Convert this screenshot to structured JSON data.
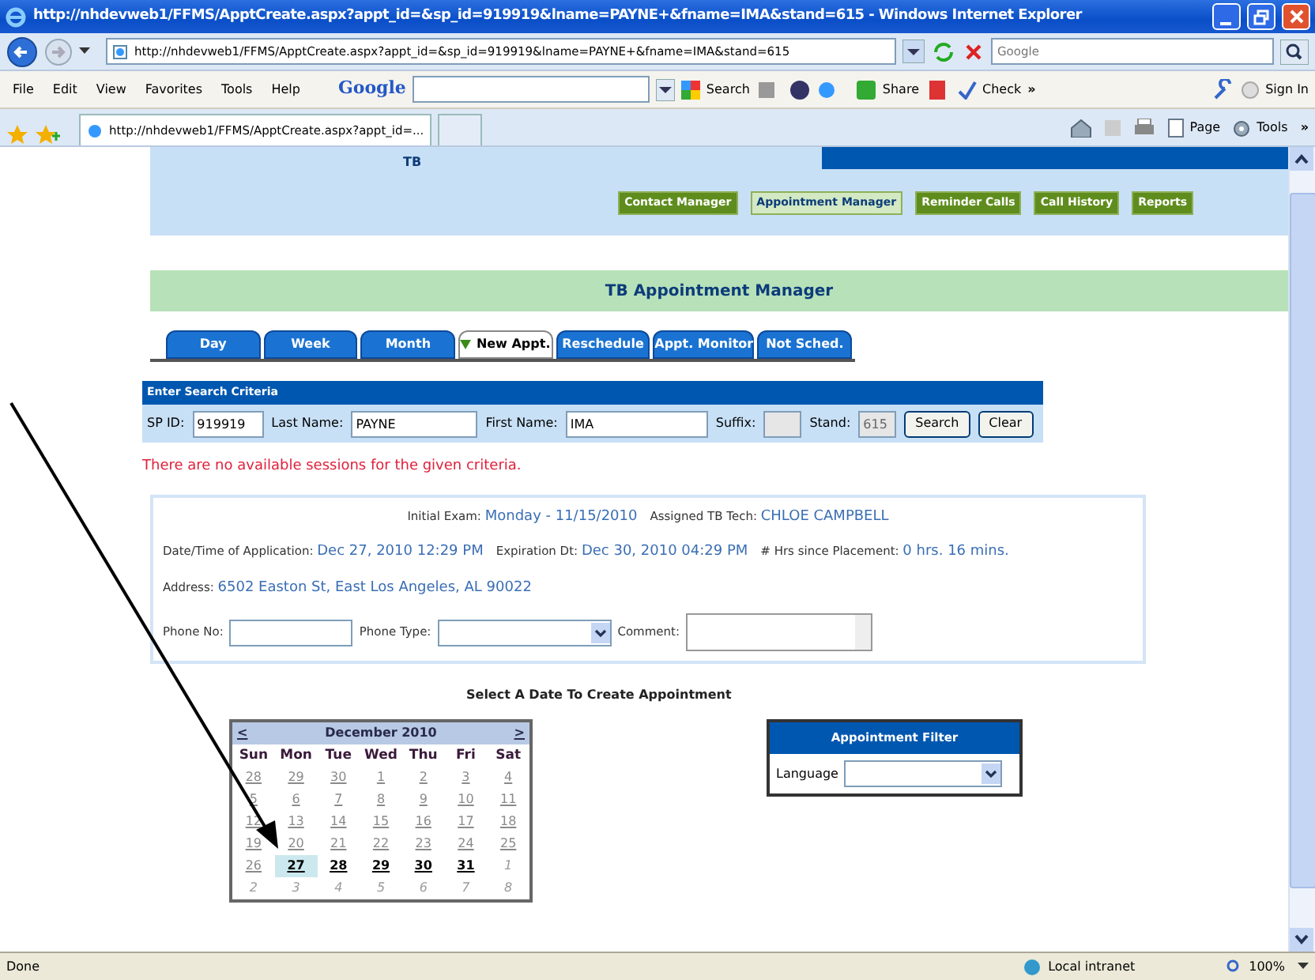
{
  "window": {
    "title": "http://nhdevweb1/FFMS/ApptCreate.aspx?appt_id=&sp_id=919919&lname=PAYNE+&fname=IMA&stand=615 - Windows Internet Explorer"
  },
  "address_bar": {
    "url": "http://nhdevweb1/FFMS/ApptCreate.aspx?appt_id=&sp_id=919919&lname=PAYNE+&fname=IMA&stand=615",
    "search_placeholder": "Google"
  },
  "menu": [
    "File",
    "Edit",
    "View",
    "Favorites",
    "Tools",
    "Help"
  ],
  "google_toolbar": {
    "logo": "Google",
    "search": "Search",
    "share": "Share",
    "check": "Check",
    "more": "»",
    "sign_in": "Sign In"
  },
  "browser_tab": {
    "title": "http://nhdevweb1/FFMS/ApptCreate.aspx?appt_id=..."
  },
  "command_bar": {
    "page": "Page",
    "tools": "Tools",
    "more": "»"
  },
  "page": {
    "header_label": "TB",
    "nav": [
      {
        "label": "Contact Manager",
        "selected": false
      },
      {
        "label": "Appointment Manager",
        "selected": true
      },
      {
        "label": "Reminder Calls",
        "selected": false
      },
      {
        "label": "Call History",
        "selected": false
      },
      {
        "label": "Reports",
        "selected": false
      }
    ],
    "title": "TB Appointment Manager",
    "tabs": [
      {
        "label": "Day",
        "selected": false
      },
      {
        "label": "Week",
        "selected": false
      },
      {
        "label": "Month",
        "selected": false
      },
      {
        "label": "New Appt.",
        "selected": true
      },
      {
        "label": "Reschedule",
        "selected": false
      },
      {
        "label": "Appt. Monitor",
        "selected": false
      },
      {
        "label": "Not Sched.",
        "selected": false
      }
    ],
    "search": {
      "header": "Enter Search Criteria",
      "fields": [
        {
          "label": "SP ID:",
          "value": "919919",
          "disabled": false
        },
        {
          "label": "Last Name:",
          "value": "PAYNE",
          "disabled": false
        },
        {
          "label": "First Name:",
          "value": "IMA",
          "disabled": false
        },
        {
          "label": "Suffix:",
          "disabled": true
        },
        {
          "label": "Stand:",
          "value": "615",
          "disabled": true
        }
      ],
      "buttons": [
        "Search",
        "Clear"
      ]
    },
    "error": "There are no available sessions for the given criteria.",
    "info": {
      "rows": [
        [
          {
            "label": "Initial Exam:",
            "value": "Monday - 11/15/2010"
          },
          {
            "label": "Assigned TB Tech:",
            "value": "CHLOE CAMPBELL"
          }
        ],
        [
          {
            "label": "Date/Time of Application:",
            "value": "Dec 27, 2010 12:29 PM"
          },
          {
            "label": "Expiration Dt:",
            "value": "Dec 30, 2010 04:29 PM"
          },
          {
            "label": "# Hrs since Placement:",
            "value": "0 hrs. 16 mins."
          }
        ],
        [
          {
            "label": "Address:",
            "value": "6502 Easton St, East Los Angeles, AL 90022"
          }
        ]
      ],
      "phone_no_label": "Phone No:",
      "phone_type_label": "Phone Type:",
      "comment_label": "Comment:"
    },
    "select_heading": "Select A Date To Create Appointment",
    "calendar": {
      "prev": "<",
      "next": ">",
      "month": "December 2010",
      "weekdays": [
        "Sun",
        "Mon",
        "Tue",
        "Wed",
        "Thu",
        "Fri",
        "Sat"
      ],
      "weeks": [
        [
          {
            "day": "28",
            "available": false,
            "outside": false,
            "selected": false
          },
          {
            "day": "29",
            "available": false,
            "outside": false,
            "selected": false
          },
          {
            "day": "30",
            "available": false,
            "outside": false,
            "selected": false
          },
          {
            "day": "1",
            "available": false,
            "outside": false,
            "selected": false
          },
          {
            "day": "2",
            "available": false,
            "outside": false,
            "selected": false
          },
          {
            "day": "3",
            "available": false,
            "outside": false,
            "selected": false
          },
          {
            "day": "4",
            "available": false,
            "outside": false,
            "selected": false
          }
        ],
        [
          {
            "day": "5",
            "available": false,
            "outside": false,
            "selected": false
          },
          {
            "day": "6",
            "available": false,
            "outside": false,
            "selected": false
          },
          {
            "day": "7",
            "available": false,
            "outside": false,
            "selected": false
          },
          {
            "day": "8",
            "available": false,
            "outside": false,
            "selected": false
          },
          {
            "day": "9",
            "available": false,
            "outside": false,
            "selected": false
          },
          {
            "day": "10",
            "available": false,
            "outside": false,
            "selected": false
          },
          {
            "day": "11",
            "available": false,
            "outside": false,
            "selected": false
          }
        ],
        [
          {
            "day": "12",
            "available": false,
            "outside": false,
            "selected": false
          },
          {
            "day": "13",
            "available": false,
            "outside": false,
            "selected": false
          },
          {
            "day": "14",
            "available": false,
            "outside": false,
            "selected": false
          },
          {
            "day": "15",
            "available": false,
            "outside": false,
            "selected": false
          },
          {
            "day": "16",
            "available": false,
            "outside": false,
            "selected": false
          },
          {
            "day": "17",
            "available": false,
            "outside": false,
            "selected": false
          },
          {
            "day": "18",
            "available": false,
            "outside": false,
            "selected": false
          }
        ],
        [
          {
            "day": "19",
            "available": false,
            "outside": false,
            "selected": false
          },
          {
            "day": "20",
            "available": false,
            "outside": false,
            "selected": false
          },
          {
            "day": "21",
            "available": false,
            "outside": false,
            "selected": false
          },
          {
            "day": "22",
            "available": false,
            "outside": false,
            "selected": false
          },
          {
            "day": "23",
            "available": false,
            "outside": false,
            "selected": false
          },
          {
            "day": "24",
            "available": false,
            "outside": false,
            "selected": false
          },
          {
            "day": "25",
            "available": false,
            "outside": false,
            "selected": false
          }
        ],
        [
          {
            "day": "26",
            "available": false,
            "outside": false,
            "selected": false
          },
          {
            "day": "27",
            "available": true,
            "outside": false,
            "selected": true
          },
          {
            "day": "28",
            "available": true,
            "outside": false,
            "selected": false
          },
          {
            "day": "29",
            "available": true,
            "outside": false,
            "selected": false
          },
          {
            "day": "30",
            "available": true,
            "outside": false,
            "selected": false
          },
          {
            "day": "31",
            "available": true,
            "outside": false,
            "selected": false
          },
          {
            "day": "1",
            "available": false,
            "outside": true,
            "selected": false
          }
        ],
        [
          {
            "day": "2",
            "available": false,
            "outside": true,
            "selected": false
          },
          {
            "day": "3",
            "available": false,
            "outside": true,
            "selected": false
          },
          {
            "day": "4",
            "available": false,
            "outside": true,
            "selected": false
          },
          {
            "day": "5",
            "available": false,
            "outside": true,
            "selected": false
          },
          {
            "day": "6",
            "available": false,
            "outside": true,
            "selected": false
          },
          {
            "day": "7",
            "available": false,
            "outside": true,
            "selected": false
          },
          {
            "day": "8",
            "available": false,
            "outside": true,
            "selected": false
          }
        ]
      ]
    },
    "filter": {
      "title": "Appointment Filter",
      "label": "Language"
    }
  },
  "status_bar": {
    "text": "Done",
    "zone": "Local intranet",
    "zoom": "100%"
  }
}
